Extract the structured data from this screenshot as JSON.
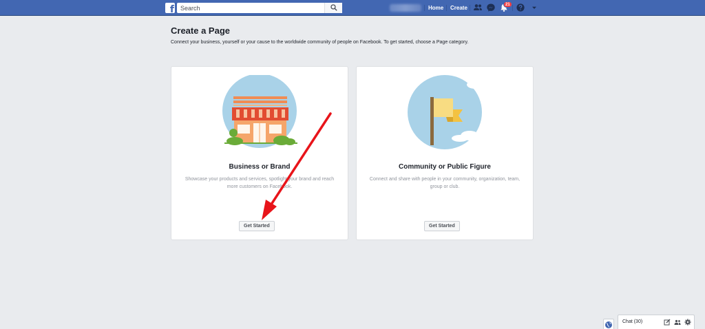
{
  "topbar": {
    "search_placeholder": "Search",
    "nav": {
      "home": "Home",
      "create": "Create"
    },
    "notifications_count": "21"
  },
  "heading": {
    "title": "Create a Page",
    "subtitle": "Connect your business, yourself or your cause to the worldwide community of people on Facebook. To get started, choose a Page category."
  },
  "cards": [
    {
      "title": "Business or Brand",
      "description": "Showcase your products and services, spotlight your brand and reach more customers on Facebook.",
      "button": "Get Started"
    },
    {
      "title": "Community or Public Figure",
      "description": "Connect and share with people in your community, organization, team, group or club.",
      "button": "Get Started"
    }
  ],
  "chat": {
    "label": "Chat (30)"
  },
  "colors": {
    "brand": "#4267b2",
    "background": "#e9ebee",
    "annotation_arrow": "#e8141a",
    "badge": "#fa3e3e"
  }
}
